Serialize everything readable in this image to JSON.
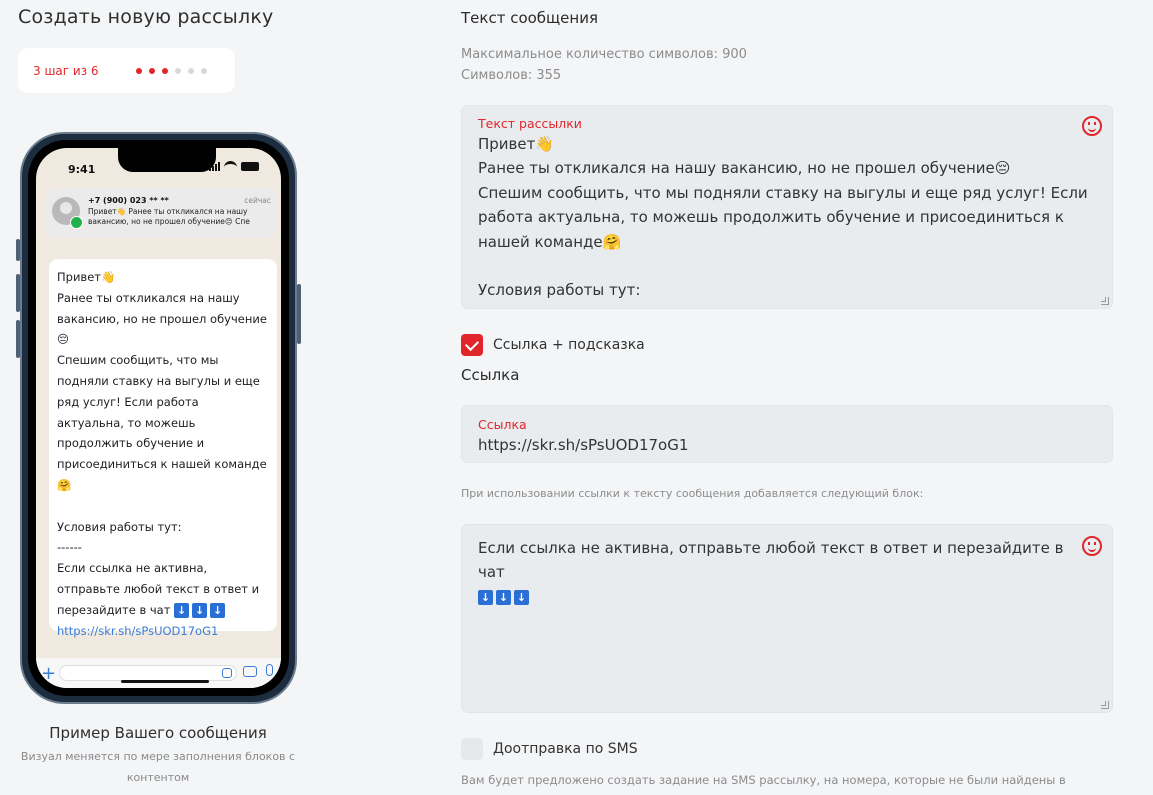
{
  "page": {
    "title": "Создать новую рассылку"
  },
  "stepper": {
    "text": "3 шаг из 6",
    "total": 6,
    "current": 3
  },
  "phone": {
    "time": "9:41",
    "notification": {
      "sender": "+7 (900) 023 ** **",
      "time": "сейчас",
      "preview": "Привет👋 Ранее ты откликался на нашу вакансию, но не прошел обучение😔 Спе"
    },
    "bubble": {
      "text": "Привет👋\nРанее ты откликался на нашу вакансию, но не прошел обучение 😔\nСпешим сообщить, что мы подняли ставку на выгулы и еще ряд услуг! Если работа актуальна, то можешь продолжить обучение и присоединиться к нашей команде🤗\n\nУсловия работы тут:\n------\nЕсли ссылка не активна, отправьте любой текст в ответ и перезайдите в чат",
      "arrows": "⬇⬇⬇",
      "link": "https://skr.sh/sPsUOD17oG1"
    }
  },
  "example": {
    "title": "Пример Вашего сообщения",
    "subtitle": "Визуал меняется по мере заполнения блоков с контентом"
  },
  "message_section": {
    "title": "Текст сообщения",
    "max_chars": "Максимальное количество символов: 900",
    "chars_count": "Символов: 355",
    "field_label": "Текст рассылки",
    "field_value": "Привет👋\nРанее ты откликался на нашу вакансию, но не прошел обучение😔\nСпешим сообщить, что мы подняли ставку на выгулы и еще ряд услуг! Если работа актуальна, то можешь продолжить обучение и присоединиться к нашей команде🤗\n\nУсловия работы тут:"
  },
  "link_checkbox": {
    "label": "Ссылка + подсказка",
    "checked": true
  },
  "link_section": {
    "title": "Ссылка",
    "field_label": "Ссылка",
    "field_value": "https://skr.sh/sPsUOD17oG1",
    "hint": "При использовании ссылки к тексту сообщения добавляется следующий блок:",
    "block_text": "Если ссылка не активна, отправьте любой текст в ответ и перезайдите в чат",
    "block_arrows": "⬇⬇⬇"
  },
  "sms_checkbox": {
    "label": "Доотправка по SMS",
    "checked": false
  },
  "sms_hint": "Вам будет предложено создать задание на SMS рассылку, на номера, которые не были найдены в",
  "colors": {
    "accent": "#e0262b",
    "field_bg": "#e9ecef",
    "page_bg": "#f4f5f7",
    "link": "#3a7bd5"
  }
}
